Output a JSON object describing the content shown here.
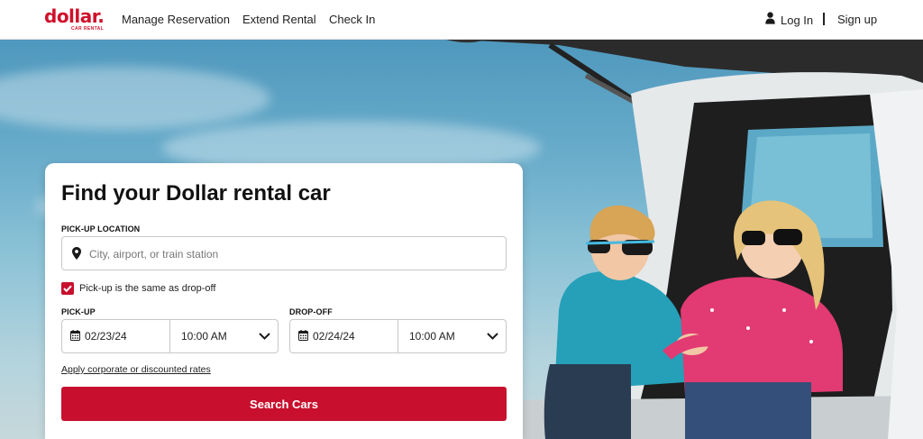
{
  "header": {
    "logo_text": "dollar.",
    "logo_subtext": "CAR RENTAL",
    "nav": [
      {
        "label": "Manage Reservation"
      },
      {
        "label": "Extend Rental"
      },
      {
        "label": "Check In"
      }
    ],
    "login_label": "Log In",
    "signup_label": "Sign up"
  },
  "search": {
    "title": "Find your Dollar rental car",
    "pickup_location_label": "PICK-UP LOCATION",
    "location_placeholder": "City, airport, or train station",
    "location_value": "",
    "same_dropoff_label": "Pick-up is the same as drop-off",
    "same_dropoff_checked": true,
    "pickup_label": "PICK-UP",
    "pickup_date": "02/23/24",
    "pickup_time": "10:00 AM",
    "dropoff_label": "DROP-OFF",
    "dropoff_date": "02/24/24",
    "dropoff_time": "10:00 AM",
    "rates_link": "Apply corporate or discounted rates",
    "search_button": "Search Cars"
  },
  "colors": {
    "brand_red": "#c8102e",
    "logo_red": "#d0102b",
    "hero_sky": "#6aadcb"
  },
  "icons": [
    "user-icon",
    "map-pin-icon",
    "check-icon",
    "calendar-icon",
    "chevron-down-icon"
  ],
  "hero_image": "Two children wearing sunglasses sitting in the open trunk of a white car under a blue sky"
}
